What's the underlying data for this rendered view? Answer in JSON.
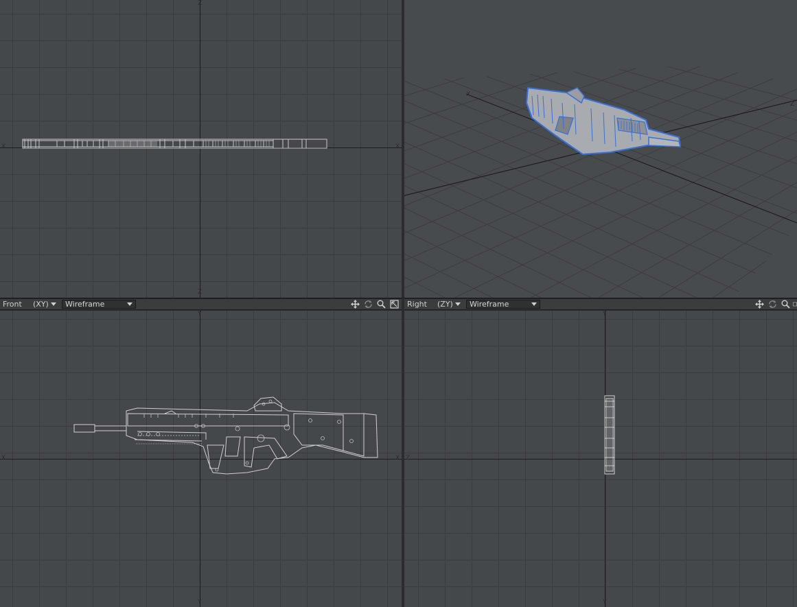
{
  "viewports": {
    "top": {
      "axis_labels": [
        "Z",
        "X",
        "X",
        "Z"
      ]
    },
    "perspective": {
      "axis_labels": [
        "X",
        "Z"
      ]
    },
    "front": {
      "view_label": "Front",
      "axis_label": "(XY)",
      "mode": "Wireframe",
      "axis_labels": [
        "Y",
        "X",
        "X",
        "Y"
      ]
    },
    "right": {
      "view_label": "Right",
      "axis_label": "(ZY)",
      "mode": "Wireframe",
      "axis_labels": [
        "Y",
        "Z",
        "Y"
      ]
    }
  },
  "icons": [
    "move-icon",
    "rotate-icon",
    "zoom-icon",
    "maximize-icon"
  ],
  "colors": {
    "viewport_bg": "#45484b",
    "grid_line": "#3a3c3f",
    "wire_gray": "#c8c8c8",
    "selected_blue": "#3a6fd6"
  }
}
